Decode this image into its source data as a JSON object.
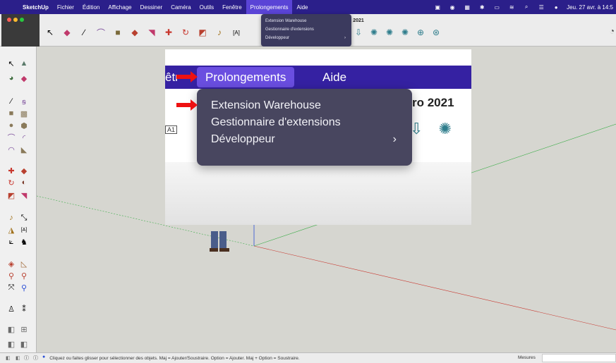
{
  "menubar": {
    "app": "SketchUp",
    "items": [
      "Fichier",
      "Édition",
      "Affichage",
      "Dessiner",
      "Caméra",
      "Outils",
      "Fenêtre",
      "Prolongements",
      "Aide"
    ],
    "active_index": 7,
    "clock": "Jeu. 27 avr. à 14:5"
  },
  "small_dropdown": {
    "items": [
      "Extension Warehouse",
      "Gestionnaire d'extensions",
      "Développeur"
    ],
    "submenu_marker": "›"
  },
  "window": {
    "title_fragment": "o 2021"
  },
  "zoom": {
    "menu_left_fragment": "êtr",
    "active_menu": "Prolongements",
    "next_menu": "Aide",
    "title_fragment": "ro 2021",
    "a1_label": "A1",
    "dropdown_items": [
      "Extension Warehouse",
      "Gestionnaire d'extensions",
      "Développeur"
    ],
    "submenu_marker": "›"
  },
  "statusbar": {
    "message": "Cliquez ou faites glisser pour sélectionner des objets. Maj = Ajouter/Soustraire. Option = Ajouter. Maj + Option = Soustraire.",
    "measures_label": "Mesures"
  },
  "colors": {
    "menubar": "#2b1f8a",
    "menu_active": "#5a44d6",
    "dropdown": "#48465f",
    "arrow": "#ee1111",
    "axis_red": "#c8382f",
    "axis_green": "#3fae4b",
    "axis_blue": "#2b4fd6"
  }
}
